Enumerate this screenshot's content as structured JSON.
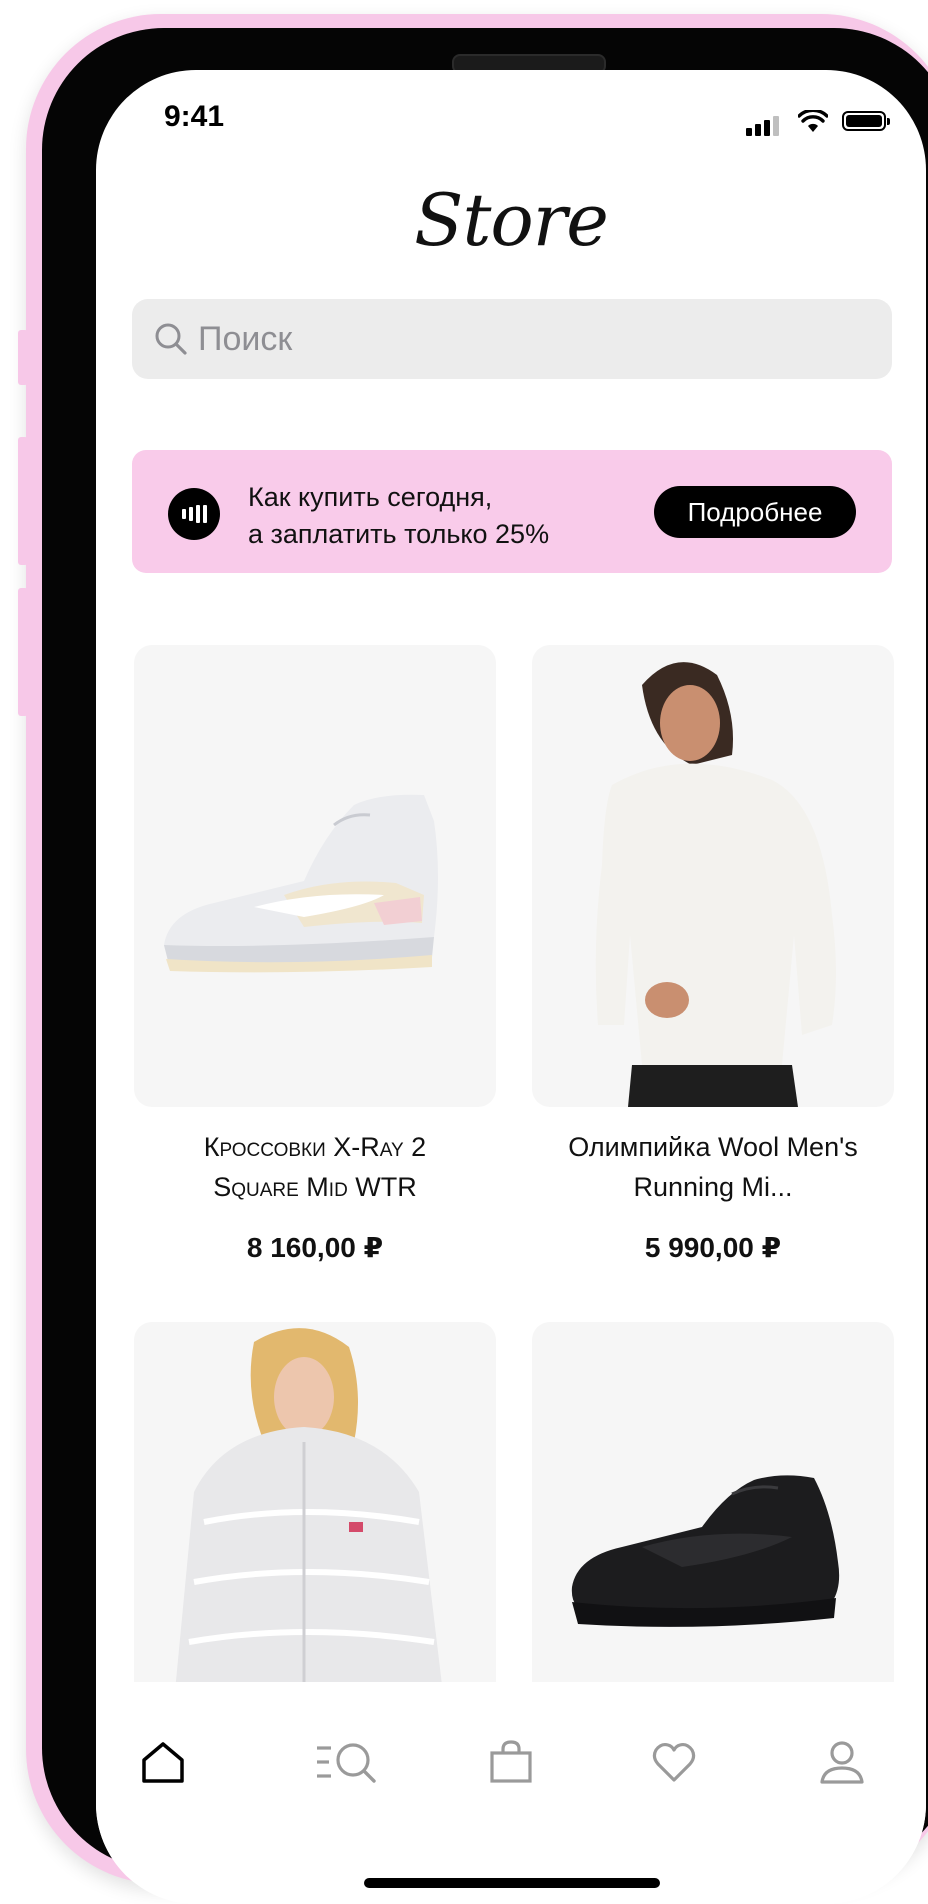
{
  "status_bar": {
    "time": "9:41"
  },
  "header": {
    "title": "Store"
  },
  "search": {
    "placeholder": "Поиск"
  },
  "promo": {
    "line1": "Как купить сегодня,",
    "line2": "а заплатить только 25%",
    "button_label": "Подробнее",
    "accent_color": "#f9cbea"
  },
  "products": [
    {
      "name_line1": "Кроссовки X-Ray 2",
      "name_line2": "Square Mid WTR",
      "price": "8 160,00 ₽",
      "image": "white-sneaker"
    },
    {
      "name_line1": "Олимпийка Wool Men's",
      "name_line2": "Running Mi...",
      "price": "5 990,00 ₽",
      "image": "white-running-top"
    },
    {
      "name_line1": "",
      "name_line2": "",
      "price": "",
      "image": "white-puffer-jacket"
    },
    {
      "name_line1": "",
      "name_line2": "",
      "price": "",
      "image": "black-sneaker"
    }
  ],
  "tabbar": {
    "items": [
      {
        "icon": "home-icon",
        "active": true
      },
      {
        "icon": "catalog-search-icon",
        "active": false
      },
      {
        "icon": "bag-icon",
        "active": false
      },
      {
        "icon": "heart-icon",
        "active": false
      },
      {
        "icon": "profile-icon",
        "active": false
      }
    ]
  },
  "colors": {
    "phone_frame": "#f7c8e8",
    "search_bg": "#ececec",
    "tab_inactive": "#9a9a9a"
  }
}
